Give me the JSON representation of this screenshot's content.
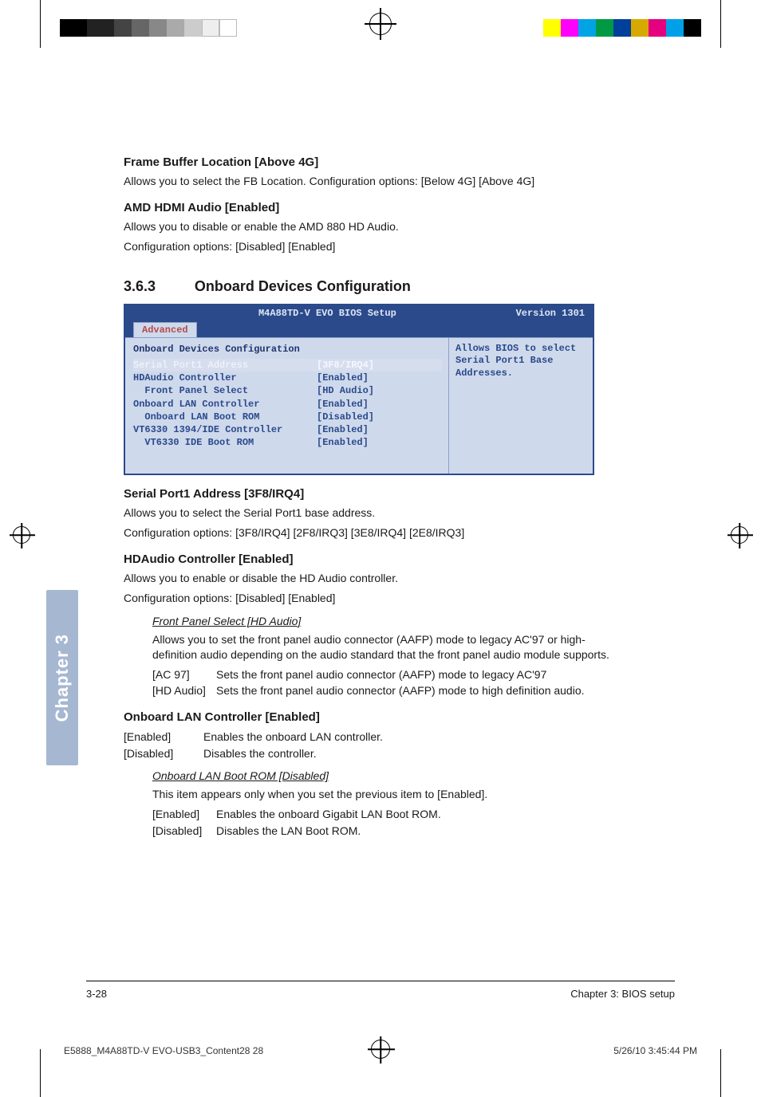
{
  "header": {
    "option1_title": "Frame Buffer Location [Above 4G]",
    "option1_desc": "Allows you to select the FB Location. Configuration options: [Below 4G] [Above 4G]",
    "option2_title": "AMD HDMI Audio [Enabled]",
    "option2_desc_l1": "Allows you to disable or enable the AMD 880 HD Audio.",
    "option2_desc_l2": "Configuration options: [Disabled] [Enabled]"
  },
  "section": {
    "num": "3.6.3",
    "title": "Onboard Devices Configuration"
  },
  "bios": {
    "title_center": "M4A88TD-V EVO BIOS Setup",
    "version": "Version 1301",
    "tab": "Advanced",
    "panel_title": "Onboard Devices Configuration",
    "rows": [
      {
        "name": "Serial Port1 Address",
        "indent": 0,
        "value": "[3F8/IRQ4]",
        "selected": true
      },
      {
        "name": "",
        "indent": 0,
        "value": ""
      },
      {
        "name": "HDAudio Controller",
        "indent": 0,
        "value": "[Enabled]"
      },
      {
        "name": "Front Panel Select",
        "indent": 1,
        "value": "[HD Audio]"
      },
      {
        "name": "Onboard LAN Controller",
        "indent": 0,
        "value": "[Enabled]"
      },
      {
        "name": "Onboard LAN Boot ROM",
        "indent": 1,
        "value": "[Disabled]"
      },
      {
        "name": "VT6330 1394/IDE Controller",
        "indent": 0,
        "value": "[Enabled]"
      },
      {
        "name": "VT6330 IDE Boot ROM",
        "indent": 1,
        "value": "[Enabled]"
      }
    ],
    "help": "Allows BIOS to select Serial Port1 Base Addresses."
  },
  "body": {
    "sp1_title": "Serial Port1 Address [3F8/IRQ4]",
    "sp1_l1": "Allows you to select the Serial Port1 base address.",
    "sp1_l2": "Configuration options: [3F8/IRQ4] [2F8/IRQ3] [3E8/IRQ4] [2E8/IRQ3]",
    "hda_title": "HDAudio Controller [Enabled]",
    "hda_l1": "Allows you to enable or disable the HD Audio controller.",
    "hda_l2": "Configuration options: [Disabled] [Enabled]",
    "fps_title": "Front Panel Select [HD Audio]",
    "fps_desc": "Allows you to set the front panel audio connector (AAFP) mode to legacy AC'97 or high-definition audio depending on the audio standard that the front panel audio module supports.",
    "fps_opts": [
      {
        "k": "[AC 97]",
        "v": "Sets the front panel audio connector (AAFP) mode to legacy AC'97"
      },
      {
        "k": "[HD Audio]",
        "v": "Sets the front panel audio connector (AAFP) mode to high definition audio."
      }
    ],
    "lan_title": "Onboard LAN Controller [Enabled]",
    "lan_opts": [
      {
        "k": "[Enabled]",
        "v": "Enables the onboard LAN controller."
      },
      {
        "k": "[Disabled]",
        "v": "Disables the controller."
      }
    ],
    "lanrom_title": "Onboard LAN Boot ROM [Disabled]",
    "lanrom_desc": "This item appears only when you set the previous item to [Enabled].",
    "lanrom_opts": [
      {
        "k": "[Enabled]",
        "v": "Enables the onboard Gigabit LAN Boot ROM."
      },
      {
        "k": "[Disabled]",
        "v": "Disables the LAN Boot ROM."
      }
    ]
  },
  "chapter_tab": "Chapter 3",
  "footer": {
    "left": "3-28",
    "right": "Chapter 3: BIOS setup"
  },
  "printfoot": {
    "left": "E5888_M4A88TD-V EVO-USB3_Content28   28",
    "right": "5/26/10   3:45:44 PM"
  },
  "reg_colors_left": [
    "#000",
    "#222",
    "#444",
    "#666",
    "#888",
    "#aaa",
    "#ccc",
    "#eee",
    "#fff"
  ],
  "reg_colors_right": [
    "#ffff00",
    "#ff00ff",
    "#00a4e4",
    "#009944",
    "#003f9a",
    "#d7a900",
    "#e4007f",
    "#00a0e9",
    "#000"
  ]
}
